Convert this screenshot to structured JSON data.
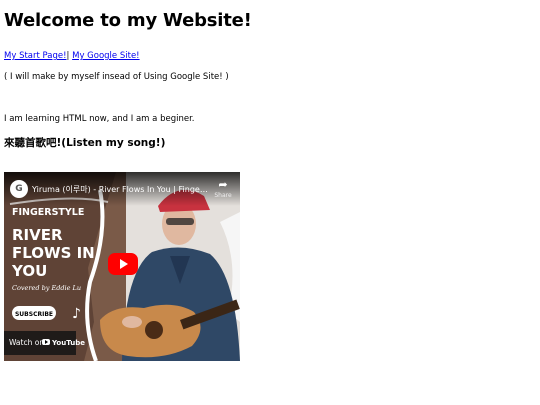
{
  "page": {
    "heading": "Welcome to my Website!",
    "links": [
      {
        "label": "My Start Page!"
      },
      {
        "label": "My Google Site!"
      }
    ],
    "link_separator": "|",
    "note": "( I will make by myself insead of Using Google Site! )",
    "learning_text": "I am learning HTML now, and I am a beginer.",
    "listen_prefix": "來聽首歌吧!",
    "listen_bracketed": "(Listen my song!)"
  },
  "video": {
    "channel_initial": "G",
    "title": "Yiruma (이루마) - River Flows In You | Fingerstyle c...",
    "share_label": "Share",
    "thumbnail_lines": [
      "FINGERSTYLE",
      "RIVER",
      "FLOWS IN",
      "YOU"
    ],
    "cover_credit": "Covered by Eddie Lu",
    "subscribe_label": "SUBSCRIBE",
    "watch_on_label": "Watch on",
    "youtube_word": "YouTube"
  },
  "colors": {
    "link": "#0000ee",
    "thumbnail_bg": "#7d5f4d",
    "play_button": "#ff0000",
    "cap": "#c8323f"
  }
}
